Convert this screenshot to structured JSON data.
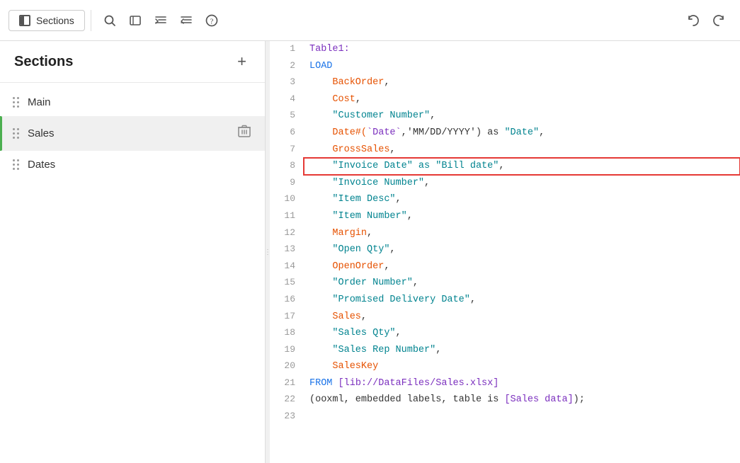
{
  "toolbar": {
    "sections_button_label": "Sections",
    "icons": [
      "search",
      "code-block",
      "indent-increase",
      "indent-decrease",
      "help-circle"
    ],
    "undo_label": "undo",
    "redo_label": "redo"
  },
  "sidebar": {
    "title": "Sections",
    "add_button_label": "+",
    "items": [
      {
        "id": "main",
        "label": "Main",
        "active": false
      },
      {
        "id": "sales",
        "label": "Sales",
        "active": true
      },
      {
        "id": "dates",
        "label": "Dates",
        "active": false
      }
    ]
  },
  "editor": {
    "lines": [
      {
        "num": 1,
        "tokens": [
          {
            "text": "Table1:",
            "class": "c-purple"
          }
        ],
        "highlighted": false
      },
      {
        "num": 2,
        "tokens": [
          {
            "text": "LOAD",
            "class": "c-blue"
          }
        ],
        "highlighted": false
      },
      {
        "num": 3,
        "tokens": [
          {
            "text": "    BackOrder",
            "class": "c-orange"
          },
          {
            "text": ",",
            "class": "c-dark"
          }
        ],
        "highlighted": false
      },
      {
        "num": 4,
        "tokens": [
          {
            "text": "    Cost",
            "class": "c-orange"
          },
          {
            "text": ",",
            "class": "c-dark"
          }
        ],
        "highlighted": false
      },
      {
        "num": 5,
        "tokens": [
          {
            "text": "    ",
            "class": "c-dark"
          },
          {
            "text": "\"Customer Number\"",
            "class": "c-teal"
          },
          {
            "text": ",",
            "class": "c-dark"
          }
        ],
        "highlighted": false
      },
      {
        "num": 6,
        "tokens": [
          {
            "text": "    Date#(",
            "class": "c-orange"
          },
          {
            "text": "`Date`",
            "class": "c-purple"
          },
          {
            "text": ",'MM/DD/YYYY') as ",
            "class": "c-dark"
          },
          {
            "text": "\"Date\"",
            "class": "c-teal"
          },
          {
            "text": ",",
            "class": "c-dark"
          }
        ],
        "highlighted": false
      },
      {
        "num": 7,
        "tokens": [
          {
            "text": "    GrossSales",
            "class": "c-orange"
          },
          {
            "text": ",",
            "class": "c-dark"
          }
        ],
        "highlighted": false
      },
      {
        "num": 8,
        "tokens": [
          {
            "text": "    ",
            "class": "c-dark"
          },
          {
            "text": "\"Invoice Date\" as \"Bill date\"",
            "class": "c-teal"
          },
          {
            "text": ",",
            "class": "c-dark"
          }
        ],
        "highlighted": true
      },
      {
        "num": 9,
        "tokens": [
          {
            "text": "    ",
            "class": "c-dark"
          },
          {
            "text": "\"Invoice Number\"",
            "class": "c-teal"
          },
          {
            "text": ",",
            "class": "c-dark"
          }
        ],
        "highlighted": false
      },
      {
        "num": 10,
        "tokens": [
          {
            "text": "    ",
            "class": "c-dark"
          },
          {
            "text": "\"Item Desc\"",
            "class": "c-teal"
          },
          {
            "text": ",",
            "class": "c-dark"
          }
        ],
        "highlighted": false
      },
      {
        "num": 11,
        "tokens": [
          {
            "text": "    ",
            "class": "c-dark"
          },
          {
            "text": "\"Item Number\"",
            "class": "c-teal"
          },
          {
            "text": ",",
            "class": "c-dark"
          }
        ],
        "highlighted": false
      },
      {
        "num": 12,
        "tokens": [
          {
            "text": "    Margin",
            "class": "c-orange"
          },
          {
            "text": ",",
            "class": "c-dark"
          }
        ],
        "highlighted": false
      },
      {
        "num": 13,
        "tokens": [
          {
            "text": "    ",
            "class": "c-dark"
          },
          {
            "text": "\"Open Qty\"",
            "class": "c-teal"
          },
          {
            "text": ",",
            "class": "c-dark"
          }
        ],
        "highlighted": false
      },
      {
        "num": 14,
        "tokens": [
          {
            "text": "    OpenOrder",
            "class": "c-orange"
          },
          {
            "text": ",",
            "class": "c-dark"
          }
        ],
        "highlighted": false
      },
      {
        "num": 15,
        "tokens": [
          {
            "text": "    ",
            "class": "c-dark"
          },
          {
            "text": "\"Order Number\"",
            "class": "c-teal"
          },
          {
            "text": ",",
            "class": "c-dark"
          }
        ],
        "highlighted": false
      },
      {
        "num": 16,
        "tokens": [
          {
            "text": "    ",
            "class": "c-dark"
          },
          {
            "text": "\"Promised Delivery Date\"",
            "class": "c-teal"
          },
          {
            "text": ",",
            "class": "c-dark"
          }
        ],
        "highlighted": false
      },
      {
        "num": 17,
        "tokens": [
          {
            "text": "    Sales",
            "class": "c-orange"
          },
          {
            "text": ",",
            "class": "c-dark"
          }
        ],
        "highlighted": false
      },
      {
        "num": 18,
        "tokens": [
          {
            "text": "    ",
            "class": "c-dark"
          },
          {
            "text": "\"Sales Qty\"",
            "class": "c-teal"
          },
          {
            "text": ",",
            "class": "c-dark"
          }
        ],
        "highlighted": false
      },
      {
        "num": 19,
        "tokens": [
          {
            "text": "    ",
            "class": "c-dark"
          },
          {
            "text": "\"Sales Rep Number\"",
            "class": "c-teal"
          },
          {
            "text": ",",
            "class": "c-dark"
          }
        ],
        "highlighted": false
      },
      {
        "num": 20,
        "tokens": [
          {
            "text": "    SalesKey",
            "class": "c-orange"
          }
        ],
        "highlighted": false
      },
      {
        "num": 21,
        "tokens": [
          {
            "text": "FROM ",
            "class": "c-blue"
          },
          {
            "text": "[lib://DataFiles/Sales.xlsx]",
            "class": "c-purple"
          }
        ],
        "highlighted": false
      },
      {
        "num": 22,
        "tokens": [
          {
            "text": "(ooxml, embedded labels, table is ",
            "class": "c-dark"
          },
          {
            "text": "[Sales data]",
            "class": "c-purple"
          },
          {
            "text": ");",
            "class": "c-dark"
          }
        ],
        "highlighted": false
      },
      {
        "num": 23,
        "tokens": [],
        "highlighted": false
      }
    ]
  }
}
